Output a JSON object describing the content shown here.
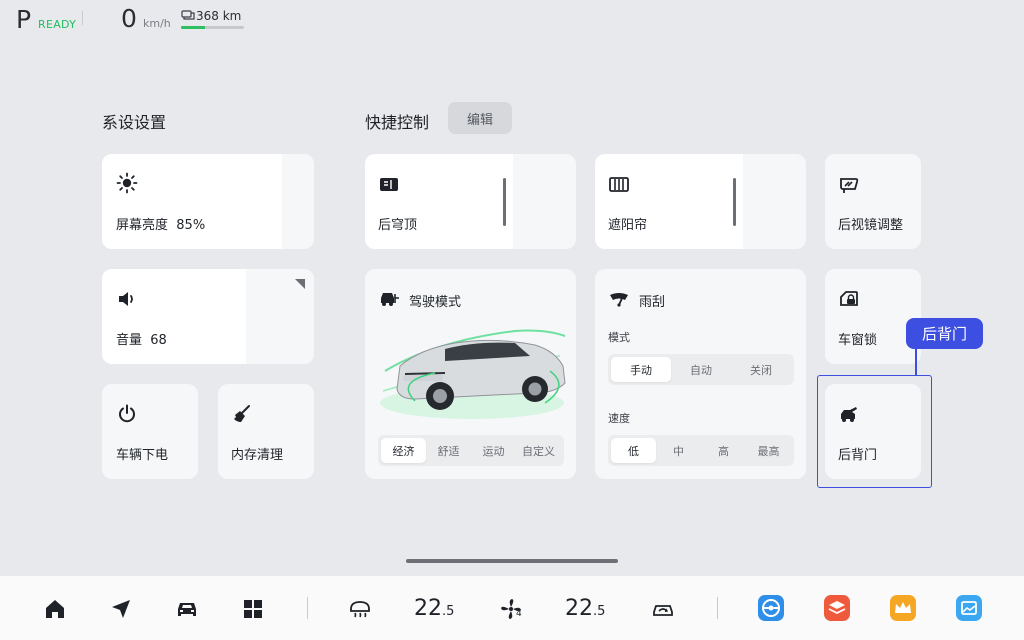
{
  "status": {
    "gear": "P",
    "ready": "READY",
    "speed": "0",
    "speed_unit": "km/h",
    "range": "368 km",
    "range_level": 0.38
  },
  "system_settings": {
    "title": "系设设置",
    "brightness": {
      "label": "屏幕亮度",
      "value": "85%",
      "level": 0.85
    },
    "volume": {
      "label": "音量",
      "value": "68",
      "level": 0.68
    },
    "power_off": {
      "label": "车辆下电"
    },
    "memory_clean": {
      "label": "内存清理"
    }
  },
  "quick_controls": {
    "title": "快捷控制",
    "edit_label": "编辑",
    "sunroof": {
      "label": "后穹顶",
      "level": 0.7
    },
    "sunshade": {
      "label": "遮阳帘",
      "level": 0.7
    },
    "mirror": {
      "label": "后视镜调整"
    },
    "drive_mode": {
      "label": "驾驶模式",
      "options": [
        "经济",
        "舒适",
        "运动",
        "自定义"
      ],
      "selected": "经济"
    },
    "wiper": {
      "label": "雨刮",
      "mode_label": "模式",
      "modes": [
        "手动",
        "自动",
        "关闭"
      ],
      "mode_selected": "手动",
      "speed_label": "速度",
      "speeds": [
        "低",
        "中",
        "高",
        "最高"
      ],
      "speed_selected": "低"
    },
    "window_lock": {
      "label": "车窗锁"
    },
    "tailgate": {
      "label": "后背门"
    }
  },
  "highlight": {
    "tag": "后背门",
    "color": "#3d4fe0"
  },
  "dock": {
    "temp_left_int": "22",
    "temp_left_dec": ".5",
    "temp_right_int": "22",
    "temp_right_dec": ".5",
    "fan_level": "4",
    "icons": [
      "home-icon",
      "navigation-icon",
      "car-icon",
      "apps-grid-icon",
      "rear-defrost-icon",
      "fan-icon",
      "recirculation-icon"
    ],
    "apps": [
      "steering-app",
      "stack-app",
      "crown-app",
      "gallery-app"
    ]
  }
}
